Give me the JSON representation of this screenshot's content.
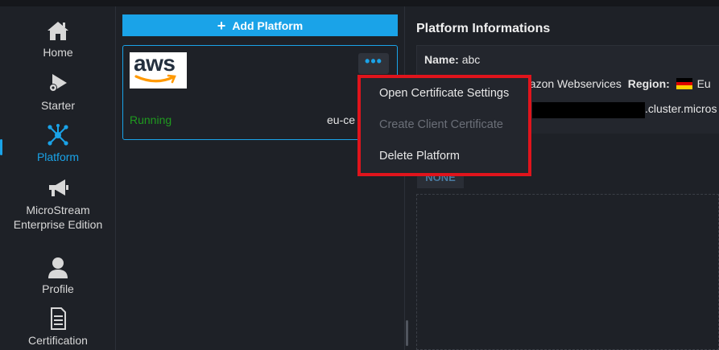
{
  "sidebar": {
    "items": [
      {
        "label": "Home",
        "icon": "home-icon",
        "active": false
      },
      {
        "label": "Starter",
        "icon": "rocket-gear-icon",
        "active": false
      },
      {
        "label": "Platform",
        "icon": "network-icon",
        "active": true
      },
      {
        "label": "MicroStream Enterprise Edition",
        "icon": "megaphone-icon",
        "active": false
      },
      {
        "label": "Profile",
        "icon": "user-icon",
        "active": false
      },
      {
        "label": "Certification",
        "icon": "document-icon",
        "active": false
      }
    ]
  },
  "platforms": {
    "add_label": "Add Platform",
    "card": {
      "logo_text": "aws",
      "status": "Running",
      "region": "eu-ce",
      "more_label": "•••"
    }
  },
  "details": {
    "title": "Platform Informations",
    "name_label": "Name:",
    "name_value": "abc",
    "provider_value": "nazon Webservices",
    "region_label": "Region:",
    "region_value": "Eu",
    "host_suffix": ".cluster.micros",
    "none_label": "NONE"
  },
  "menu": {
    "items": [
      {
        "label": "Open Certificate Settings",
        "enabled": true
      },
      {
        "label": "Create Client Certificate",
        "enabled": false
      },
      {
        "label": "Delete Platform",
        "enabled": true
      }
    ],
    "highlight_color": "#e0141c"
  },
  "colors": {
    "accent": "#1aa3e8",
    "running": "#1f9b1f",
    "background": "#1e2127"
  }
}
